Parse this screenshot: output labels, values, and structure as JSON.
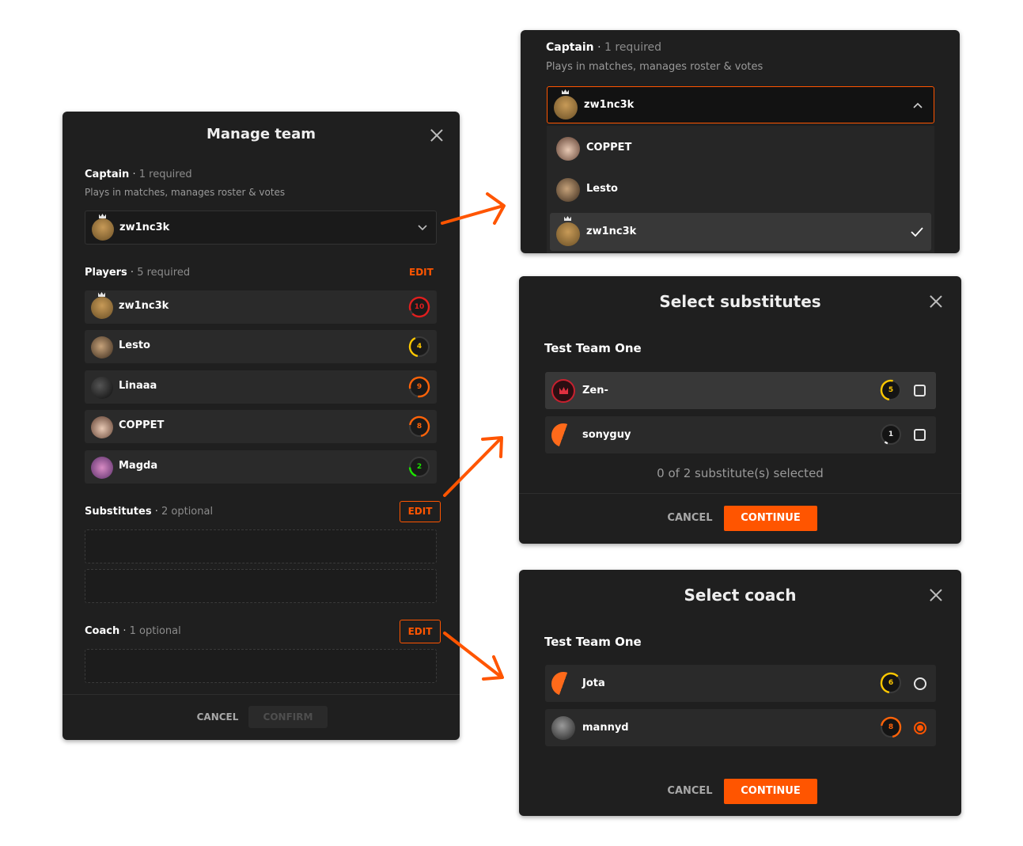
{
  "manage": {
    "title": "Manage team",
    "captain": {
      "label": "Captain",
      "count": "1 required",
      "desc": "Plays in matches, manages roster & votes",
      "selected": "zw1nc3k"
    },
    "players": {
      "label": "Players",
      "count": "5 required",
      "edit": "EDIT",
      "items": [
        {
          "name": "zw1nc3k",
          "level": "10",
          "crown": true
        },
        {
          "name": "Lesto",
          "level": "4"
        },
        {
          "name": "Linaaa",
          "level": "9"
        },
        {
          "name": "COPPET",
          "level": "8"
        },
        {
          "name": "Magda",
          "level": "2"
        }
      ]
    },
    "substitutes": {
      "label": "Substitutes",
      "count": "2 optional",
      "edit": "EDIT"
    },
    "coach": {
      "label": "Coach",
      "count": "1 optional",
      "edit": "EDIT"
    },
    "cancel": "CANCEL",
    "confirm": "CONFIRM"
  },
  "captain_dropdown": {
    "label": "Captain",
    "count": "1 required",
    "desc": "Plays in matches, manages roster & votes",
    "selected": "zw1nc3k",
    "options": [
      {
        "name": "COPPET"
      },
      {
        "name": "Lesto"
      },
      {
        "name": "zw1nc3k",
        "checked": true,
        "crown": true
      }
    ]
  },
  "substitutes_modal": {
    "title": "Select substitutes",
    "team": "Test Team One",
    "items": [
      {
        "name": "Zen-",
        "level": "5"
      },
      {
        "name": "sonyguy",
        "level": "1"
      }
    ],
    "status": "0 of 2 substitute(s) selected",
    "cancel": "CANCEL",
    "continue": "CONTINUE"
  },
  "coach_modal": {
    "title": "Select coach",
    "team": "Test Team One",
    "items": [
      {
        "name": "Jota",
        "level": "6",
        "selected": false
      },
      {
        "name": "mannyd",
        "level": "8",
        "selected": true
      }
    ],
    "cancel": "CANCEL",
    "continue": "CONTINUE"
  },
  "colors": {
    "accent": "#ff5500",
    "level_10": "#e01e1e",
    "level_8_9": "#ff6309",
    "level_4_7": "#ffc800",
    "level_2_3": "#1ce400",
    "level_1": "#eeeeee"
  },
  "icons": [
    "close-icon",
    "chevron-down-icon",
    "chevron-up-icon",
    "check-icon",
    "crown-icon",
    "level-badge-icon",
    "arrow-icon"
  ]
}
